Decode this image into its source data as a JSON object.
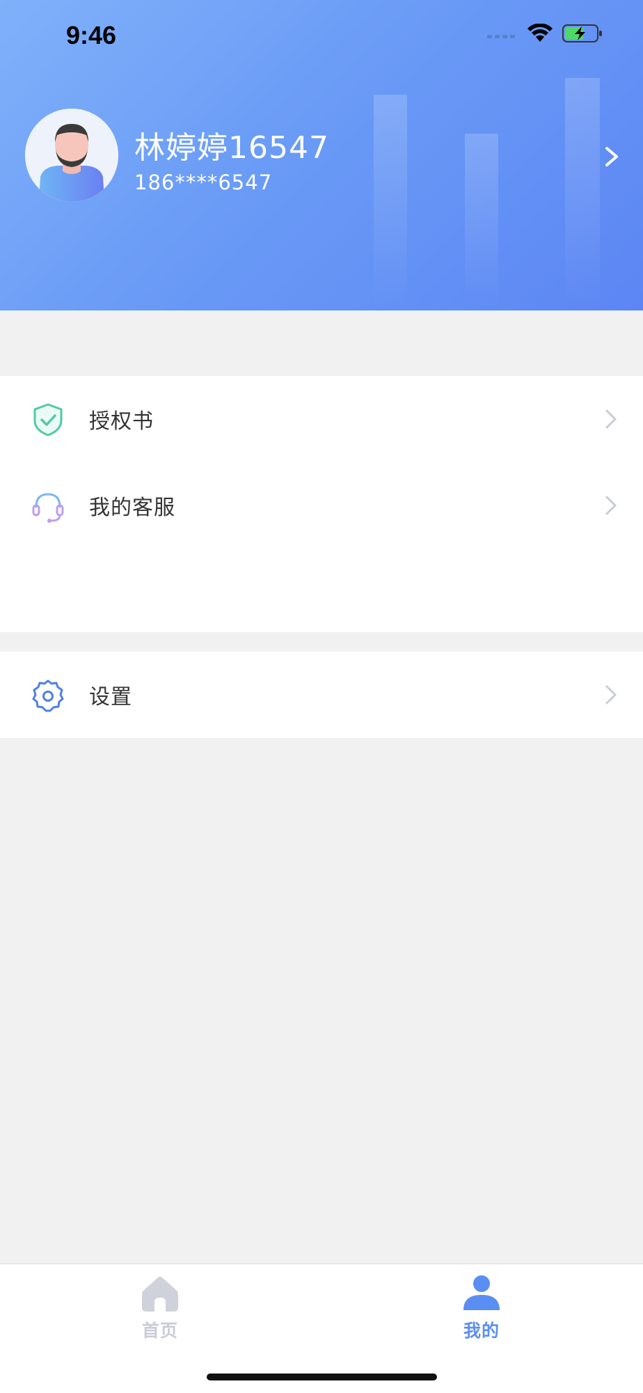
{
  "status_bar": {
    "time": "9:46"
  },
  "profile": {
    "name": "林婷婷16547",
    "phone": "186****6547"
  },
  "menu": {
    "section1": [
      {
        "label": "授权书",
        "icon": "shield-check-icon"
      },
      {
        "label": "我的客服",
        "icon": "headset-icon"
      }
    ],
    "section2": [
      {
        "label": "设置",
        "icon": "gear-icon"
      }
    ]
  },
  "tab_bar": {
    "tabs": [
      {
        "label": "首页",
        "icon": "home-icon",
        "active": false
      },
      {
        "label": "我的",
        "icon": "user-icon",
        "active": true
      }
    ]
  },
  "colors": {
    "accent": "#5b8ef2",
    "header_gradient_start": "#7fb1fa",
    "header_gradient_end": "#5c86f4",
    "shield": "#52c9a6",
    "headset": "#b49cf0",
    "gear": "#4f7fe6",
    "tab_inactive": "#c8ccd6"
  }
}
